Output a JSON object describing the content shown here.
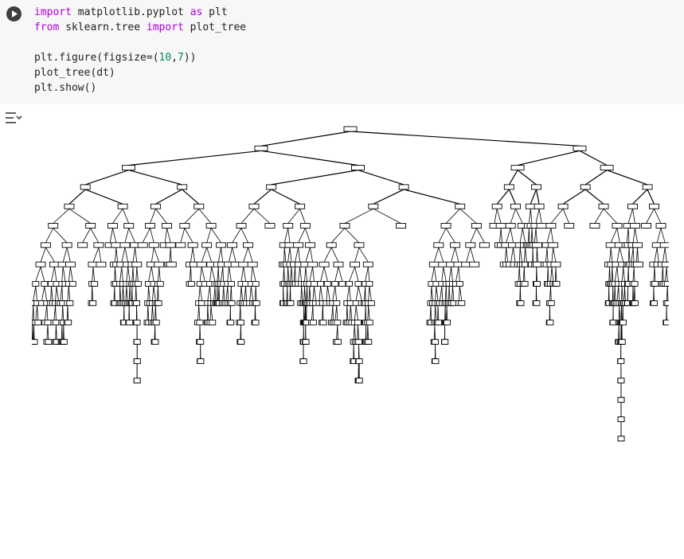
{
  "cell": {
    "lines": [
      [
        {
          "t": "import",
          "c": "kw"
        },
        {
          "t": " matplotlib.pyplot ",
          "c": "tx"
        },
        {
          "t": "as",
          "c": "kw"
        },
        {
          "t": " plt",
          "c": "tx"
        }
      ],
      [
        {
          "t": "from",
          "c": "kw"
        },
        {
          "t": " sklearn.tree ",
          "c": "tx"
        },
        {
          "t": "import",
          "c": "kw"
        },
        {
          "t": " plot_tree",
          "c": "tx"
        }
      ],
      [],
      [
        {
          "t": "plt.figure(",
          "c": "tx"
        },
        {
          "t": "figsize",
          "c": "tx"
        },
        {
          "t": "=(",
          "c": "tx"
        },
        {
          "t": "10",
          "c": "num"
        },
        {
          "t": ",",
          "c": "tx"
        },
        {
          "t": "7",
          "c": "num"
        },
        {
          "t": "))",
          "c": "tx"
        }
      ],
      [
        {
          "t": "plot_tree(dt)",
          "c": "tx"
        }
      ],
      [
        {
          "t": "plt.show()",
          "c": "tx"
        }
      ]
    ]
  },
  "colors": {
    "kw": "#af00db",
    "tx": "#212121",
    "num": "#098658",
    "cell_bg": "#f7f7f7",
    "icon": "#3c4043"
  },
  "icons": {
    "run": "play-circle-icon",
    "output": "output-settings-icon"
  },
  "chart_data": {
    "type": "tree",
    "levels_approx": 22
  }
}
